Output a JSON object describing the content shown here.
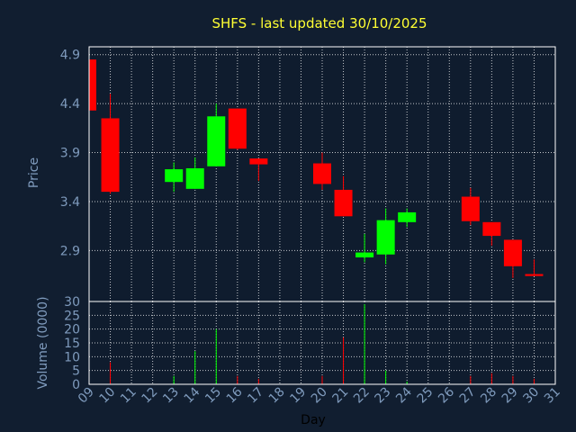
{
  "chart_data": {
    "type": "candlestick",
    "title": "SHFS - last updated 30/10/2025",
    "xlabel": "Day",
    "price_panel": {
      "ylabel": "Price",
      "ylim": [
        2.38,
        4.98
      ],
      "yticks": [
        "2.9",
        "3.4",
        "3.9",
        "4.4",
        "4.9"
      ],
      "grid": true
    },
    "volume_panel": {
      "ylabel": "Volume (0000)",
      "ylim": [
        0,
        30
      ],
      "yticks": [
        "0",
        "5",
        "10",
        "15",
        "20",
        "25",
        "30"
      ],
      "grid": true
    },
    "x_ticks": [
      "09",
      "10",
      "11",
      "12",
      "13",
      "14",
      "15",
      "16",
      "17",
      "18",
      "19",
      "20",
      "21",
      "22",
      "23",
      "24",
      "25",
      "26",
      "27",
      "28",
      "29",
      "30",
      "31"
    ],
    "candles": [
      {
        "day": 9,
        "open": 4.85,
        "high": 4.85,
        "low": 4.33,
        "close": 4.33,
        "volume": 0
      },
      {
        "day": 10,
        "open": 4.25,
        "high": 4.5,
        "low": 3.48,
        "close": 3.5,
        "volume": 8
      },
      {
        "day": 13,
        "open": 3.6,
        "high": 3.8,
        "low": 3.5,
        "close": 3.73,
        "volume": 3
      },
      {
        "day": 14,
        "open": 3.53,
        "high": 3.85,
        "low": 3.53,
        "close": 3.74,
        "volume": 12
      },
      {
        "day": 15,
        "open": 3.76,
        "high": 4.4,
        "low": 3.76,
        "close": 4.27,
        "volume": 20
      },
      {
        "day": 16,
        "open": 4.35,
        "high": 4.35,
        "low": 3.93,
        "close": 3.94,
        "volume": 3
      },
      {
        "day": 17,
        "open": 3.84,
        "high": 3.84,
        "low": 3.61,
        "close": 3.78,
        "volume": 2
      },
      {
        "day": 20,
        "open": 3.79,
        "high": 3.9,
        "low": 3.52,
        "close": 3.58,
        "volume": 3
      },
      {
        "day": 21,
        "open": 3.52,
        "high": 3.66,
        "low": 3.25,
        "close": 3.25,
        "volume": 17
      },
      {
        "day": 22,
        "open": 2.83,
        "high": 3.07,
        "low": 2.78,
        "close": 2.88,
        "volume": 29
      },
      {
        "day": 23,
        "open": 2.86,
        "high": 3.33,
        "low": 2.76,
        "close": 3.21,
        "volume": 5
      },
      {
        "day": 24,
        "open": 3.19,
        "high": 3.33,
        "low": 3.14,
        "close": 3.29,
        "volume": 1
      },
      {
        "day": 27,
        "open": 3.45,
        "high": 3.54,
        "low": 3.16,
        "close": 3.2,
        "volume": 3
      },
      {
        "day": 28,
        "open": 3.19,
        "high": 3.19,
        "low": 2.95,
        "close": 3.05,
        "volume": 4
      },
      {
        "day": 29,
        "open": 3.01,
        "high": 3.01,
        "low": 2.62,
        "close": 2.74,
        "volume": 3
      },
      {
        "day": 30,
        "open": 2.66,
        "high": 2.81,
        "low": 2.64,
        "close": 2.64,
        "volume": 2
      }
    ],
    "colors": {
      "background": "#111e30",
      "plot_background": "#0f1c2e",
      "axis": "#ffffff",
      "grid": "#ffffff",
      "up": "#00ff00",
      "down": "#ff0000",
      "tick_text": "#7f9bbd",
      "title": "#ffff33"
    }
  }
}
